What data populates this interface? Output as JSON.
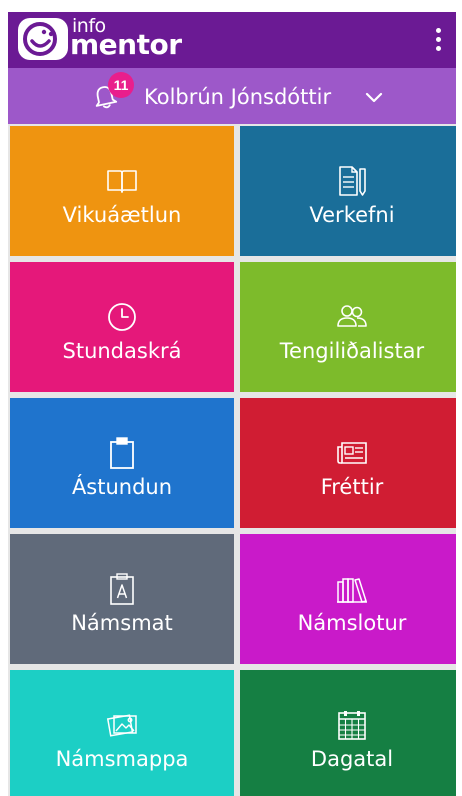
{
  "header": {
    "logo_small": "info",
    "logo_big": "mentor",
    "menu_icon": "kebab-menu-icon"
  },
  "user_bar": {
    "notification_count": "11",
    "user_name": "Kolbrún Jónsdóttir",
    "dropdown_icon": "chevron-down-icon",
    "background": "#9d58c9"
  },
  "tiles": [
    {
      "label": "Vikuáætlun",
      "icon": "book-open-icon",
      "color": "#ef9410"
    },
    {
      "label": "Verkefni",
      "icon": "document-pen-icon",
      "color": "#1a6e99"
    },
    {
      "label": "Stundaskrá",
      "icon": "clock-icon",
      "color": "#e5187a"
    },
    {
      "label": "Tengiliðalistar",
      "icon": "people-icon",
      "color": "#7dbb2b"
    },
    {
      "label": "Ástundun",
      "icon": "clipboard-icon",
      "color": "#1f74cd"
    },
    {
      "label": "Fréttir",
      "icon": "newspaper-icon",
      "color": "#d01d33"
    },
    {
      "label": "Námsmat",
      "icon": "grade-clipboard-icon",
      "color": "#606a7a"
    },
    {
      "label": "Námslotur",
      "icon": "books-icon",
      "color": "#c91ac9"
    },
    {
      "label": "Námsmappa",
      "icon": "photos-icon",
      "color": "#1ccfc5"
    },
    {
      "label": "Dagatal",
      "icon": "calendar-icon",
      "color": "#157f43"
    }
  ],
  "colors": {
    "header": "#6b1a94",
    "grid_gap": "#e6e6e6",
    "badge": "#e91e8c"
  }
}
